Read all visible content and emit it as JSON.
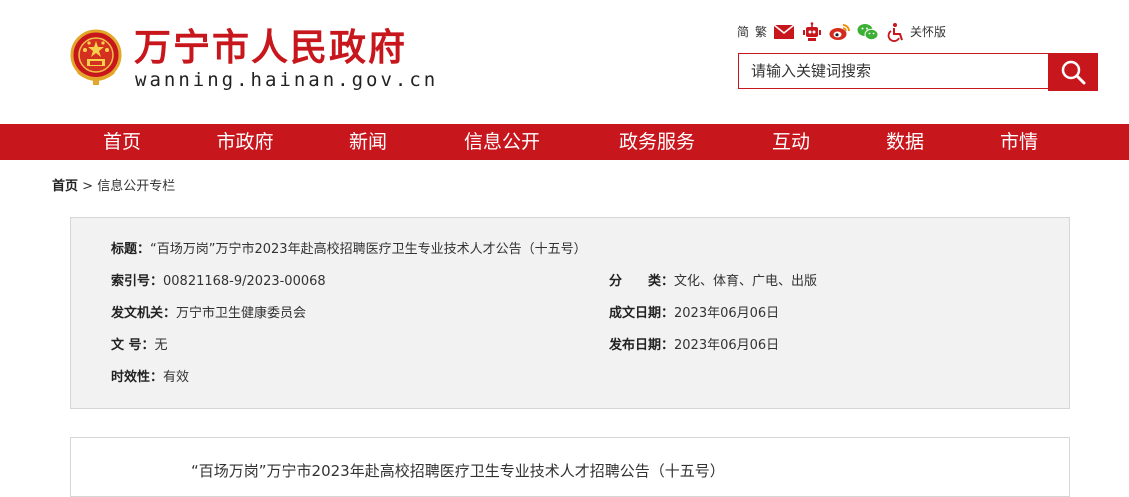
{
  "header": {
    "site_title": "万宁市人民政府",
    "site_domain": "wanning.hainan.gov.cn",
    "tools": {
      "simplified": "简",
      "traditional": "繁",
      "accessibility": "关怀版",
      "icons": [
        "mail-icon",
        "robot-icon",
        "weibo-icon",
        "wechat-icon",
        "accessibility-icon"
      ]
    },
    "search": {
      "placeholder": "请输入关键词搜索"
    }
  },
  "nav": {
    "items": [
      {
        "label": "首页"
      },
      {
        "label": "市政府"
      },
      {
        "label": "新闻"
      },
      {
        "label": "信息公开"
      },
      {
        "label": "政务服务"
      },
      {
        "label": "互动"
      },
      {
        "label": "数据"
      },
      {
        "label": "市情"
      }
    ]
  },
  "breadcrumb": {
    "home": "首页",
    "separator": " > ",
    "current": "信息公开专栏"
  },
  "meta": {
    "title_label": "标题：",
    "title_value": "“百场万岗”万宁市2023年赴高校招聘医疗卫生专业技术人才公告（十五号）",
    "index_label": "索引号：",
    "index_value": "00821168-9/2023-00068",
    "category_label": "分　　类：",
    "category_value": "文化、体育、广电、出版",
    "issuer_label": "发文机关：",
    "issuer_value": "万宁市卫生健康委员会",
    "created_label": "成文日期：",
    "created_value": "2023年06月06日",
    "docno_label": "文 号：",
    "docno_value": "无",
    "published_label": "发布日期：",
    "published_value": "2023年06月06日",
    "validity_label": "时效性：",
    "validity_value": "有效"
  },
  "article": {
    "title": "“百场万岗”万宁市2023年赴高校招聘医疗卫生专业技术人才招聘公告（十五号）"
  },
  "colors": {
    "brand_red": "#c8161d",
    "meta_bg": "#f2f2f2",
    "border": "#d6d6d6"
  }
}
